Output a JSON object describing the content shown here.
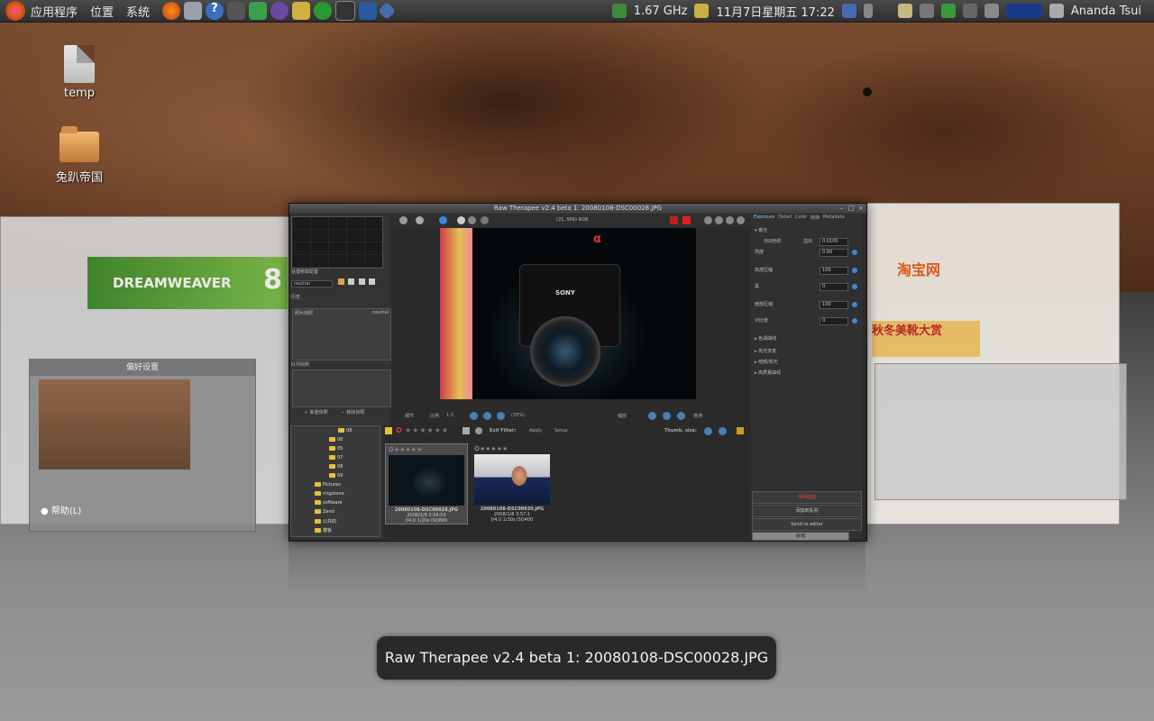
{
  "top_panel": {
    "menus": [
      "应用程序",
      "位置",
      "系统"
    ],
    "cpu_freq": "1.67 GHz",
    "clock": "11月7日星期五  17:22",
    "user": "Ananda Tsui"
  },
  "desktop": {
    "icons": [
      {
        "label": "temp"
      },
      {
        "label": "兔趴帝国"
      }
    ]
  },
  "side_windows": {
    "dreamweaver_brand": "DREAMWEAVER",
    "dreamweaver_version": "8",
    "taobao_logo": "淘宝网",
    "taobao_ad": "秋冬美靴大赏",
    "help_button": "帮助(L)",
    "mini_title": "偏好设置"
  },
  "main_window": {
    "title": "Raw Therapee v2.4 beta 1: 20080108-DSC00028.JPG",
    "left": {
      "profile_label": "处理参数配置",
      "profile_value": "neutral",
      "history_label": "历史",
      "snapshot_label": "照片快照",
      "snapshot_value": "neutral",
      "queue_label": "队列快照",
      "add_button": "新建快照",
      "remove_button": "移除快照"
    },
    "toolbar": {
      "pixel_info": "(21, 966) RGB"
    },
    "preview": {
      "brand": "SONY",
      "alpha": "α"
    },
    "zoom": {
      "label_detail": "细节",
      "ratio_label": "比例",
      "ratio_value": "1:3",
      "percent": "(33%)",
      "label_fit": "缩放",
      "label_detail2": "普通"
    },
    "right": {
      "tabs": [
        "Exposure",
        "Detail",
        "Color",
        "转换",
        "Metadata"
      ],
      "section": "曝光",
      "auto_label": "自动色阶",
      "clip_label": "溢出",
      "clip_value": "0.0100",
      "sliders": [
        {
          "label": "亮度",
          "value": "0.00"
        },
        {
          "label": "高部压缩",
          "value": "100"
        },
        {
          "label": "黑",
          "value": "0"
        },
        {
          "label": "暗部压缩",
          "value": "100"
        },
        {
          "label": "对比度",
          "value": "0"
        }
      ],
      "groups": [
        "色调曲线",
        "高光恢复",
        "暗部/高光",
        "高质量曲线"
      ],
      "save_button": "保存图像",
      "queue_button": "添加到队列",
      "send_button": "Send to editor",
      "progress_label": "就绪"
    },
    "browser": {
      "folders": [
        "08",
        "06",
        "05",
        "07",
        "08",
        "09",
        "Pictures",
        "ringstone",
        "software",
        "Zend",
        "公共的",
        "模板"
      ],
      "exif_filter": "Exif Filter:",
      "apply": "Apply",
      "setup": "Setup",
      "thumb_size": "Thumb. size:",
      "thumbs": [
        {
          "name": "20080108-DSC00028.JPG",
          "date": "2008/1/8  3:54:55",
          "info": "f/4.0 1/20s ISO800"
        },
        {
          "name": "20080108-DSC00030.JPG",
          "date": "2008/1/8  3:57:1",
          "info": "f/4.0 1/30s ISO400"
        }
      ]
    }
  },
  "tooltip": "Raw Therapee v2.4 beta 1: 20080108-DSC00028.JPG",
  "colors": {
    "panel": "#3a3a3a",
    "tooltip_bg": "#1e1e1e",
    "accent_blue": "#3a8ad4"
  }
}
